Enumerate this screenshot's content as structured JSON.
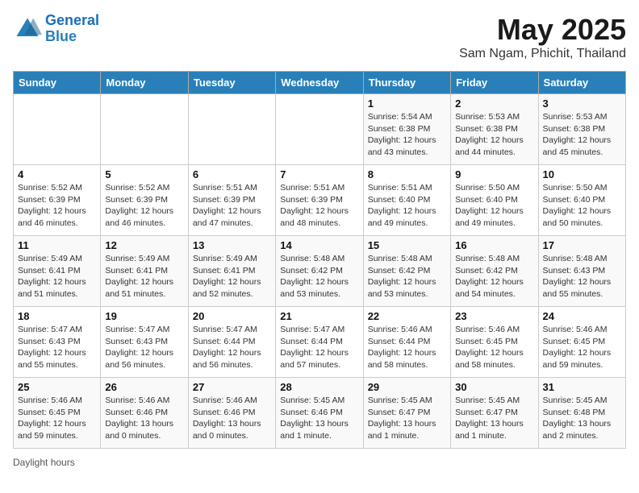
{
  "header": {
    "logo_line1": "General",
    "logo_line2": "Blue",
    "title": "May 2025",
    "subtitle": "Sam Ngam, Phichit, Thailand"
  },
  "days_of_week": [
    "Sunday",
    "Monday",
    "Tuesday",
    "Wednesday",
    "Thursday",
    "Friday",
    "Saturday"
  ],
  "weeks": [
    [
      {
        "day": "",
        "info": ""
      },
      {
        "day": "",
        "info": ""
      },
      {
        "day": "",
        "info": ""
      },
      {
        "day": "",
        "info": ""
      },
      {
        "day": "1",
        "info": "Sunrise: 5:54 AM\nSunset: 6:38 PM\nDaylight: 12 hours\nand 43 minutes."
      },
      {
        "day": "2",
        "info": "Sunrise: 5:53 AM\nSunset: 6:38 PM\nDaylight: 12 hours\nand 44 minutes."
      },
      {
        "day": "3",
        "info": "Sunrise: 5:53 AM\nSunset: 6:38 PM\nDaylight: 12 hours\nand 45 minutes."
      }
    ],
    [
      {
        "day": "4",
        "info": "Sunrise: 5:52 AM\nSunset: 6:39 PM\nDaylight: 12 hours\nand 46 minutes."
      },
      {
        "day": "5",
        "info": "Sunrise: 5:52 AM\nSunset: 6:39 PM\nDaylight: 12 hours\nand 46 minutes."
      },
      {
        "day": "6",
        "info": "Sunrise: 5:51 AM\nSunset: 6:39 PM\nDaylight: 12 hours\nand 47 minutes."
      },
      {
        "day": "7",
        "info": "Sunrise: 5:51 AM\nSunset: 6:39 PM\nDaylight: 12 hours\nand 48 minutes."
      },
      {
        "day": "8",
        "info": "Sunrise: 5:51 AM\nSunset: 6:40 PM\nDaylight: 12 hours\nand 49 minutes."
      },
      {
        "day": "9",
        "info": "Sunrise: 5:50 AM\nSunset: 6:40 PM\nDaylight: 12 hours\nand 49 minutes."
      },
      {
        "day": "10",
        "info": "Sunrise: 5:50 AM\nSunset: 6:40 PM\nDaylight: 12 hours\nand 50 minutes."
      }
    ],
    [
      {
        "day": "11",
        "info": "Sunrise: 5:49 AM\nSunset: 6:41 PM\nDaylight: 12 hours\nand 51 minutes."
      },
      {
        "day": "12",
        "info": "Sunrise: 5:49 AM\nSunset: 6:41 PM\nDaylight: 12 hours\nand 51 minutes."
      },
      {
        "day": "13",
        "info": "Sunrise: 5:49 AM\nSunset: 6:41 PM\nDaylight: 12 hours\nand 52 minutes."
      },
      {
        "day": "14",
        "info": "Sunrise: 5:48 AM\nSunset: 6:42 PM\nDaylight: 12 hours\nand 53 minutes."
      },
      {
        "day": "15",
        "info": "Sunrise: 5:48 AM\nSunset: 6:42 PM\nDaylight: 12 hours\nand 53 minutes."
      },
      {
        "day": "16",
        "info": "Sunrise: 5:48 AM\nSunset: 6:42 PM\nDaylight: 12 hours\nand 54 minutes."
      },
      {
        "day": "17",
        "info": "Sunrise: 5:48 AM\nSunset: 6:43 PM\nDaylight: 12 hours\nand 55 minutes."
      }
    ],
    [
      {
        "day": "18",
        "info": "Sunrise: 5:47 AM\nSunset: 6:43 PM\nDaylight: 12 hours\nand 55 minutes."
      },
      {
        "day": "19",
        "info": "Sunrise: 5:47 AM\nSunset: 6:43 PM\nDaylight: 12 hours\nand 56 minutes."
      },
      {
        "day": "20",
        "info": "Sunrise: 5:47 AM\nSunset: 6:44 PM\nDaylight: 12 hours\nand 56 minutes."
      },
      {
        "day": "21",
        "info": "Sunrise: 5:47 AM\nSunset: 6:44 PM\nDaylight: 12 hours\nand 57 minutes."
      },
      {
        "day": "22",
        "info": "Sunrise: 5:46 AM\nSunset: 6:44 PM\nDaylight: 12 hours\nand 58 minutes."
      },
      {
        "day": "23",
        "info": "Sunrise: 5:46 AM\nSunset: 6:45 PM\nDaylight: 12 hours\nand 58 minutes."
      },
      {
        "day": "24",
        "info": "Sunrise: 5:46 AM\nSunset: 6:45 PM\nDaylight: 12 hours\nand 59 minutes."
      }
    ],
    [
      {
        "day": "25",
        "info": "Sunrise: 5:46 AM\nSunset: 6:45 PM\nDaylight: 12 hours\nand 59 minutes."
      },
      {
        "day": "26",
        "info": "Sunrise: 5:46 AM\nSunset: 6:46 PM\nDaylight: 13 hours\nand 0 minutes."
      },
      {
        "day": "27",
        "info": "Sunrise: 5:46 AM\nSunset: 6:46 PM\nDaylight: 13 hours\nand 0 minutes."
      },
      {
        "day": "28",
        "info": "Sunrise: 5:45 AM\nSunset: 6:46 PM\nDaylight: 13 hours\nand 1 minute."
      },
      {
        "day": "29",
        "info": "Sunrise: 5:45 AM\nSunset: 6:47 PM\nDaylight: 13 hours\nand 1 minute."
      },
      {
        "day": "30",
        "info": "Sunrise: 5:45 AM\nSunset: 6:47 PM\nDaylight: 13 hours\nand 1 minute."
      },
      {
        "day": "31",
        "info": "Sunrise: 5:45 AM\nSunset: 6:48 PM\nDaylight: 13 hours\nand 2 minutes."
      }
    ]
  ],
  "footer": "Daylight hours"
}
